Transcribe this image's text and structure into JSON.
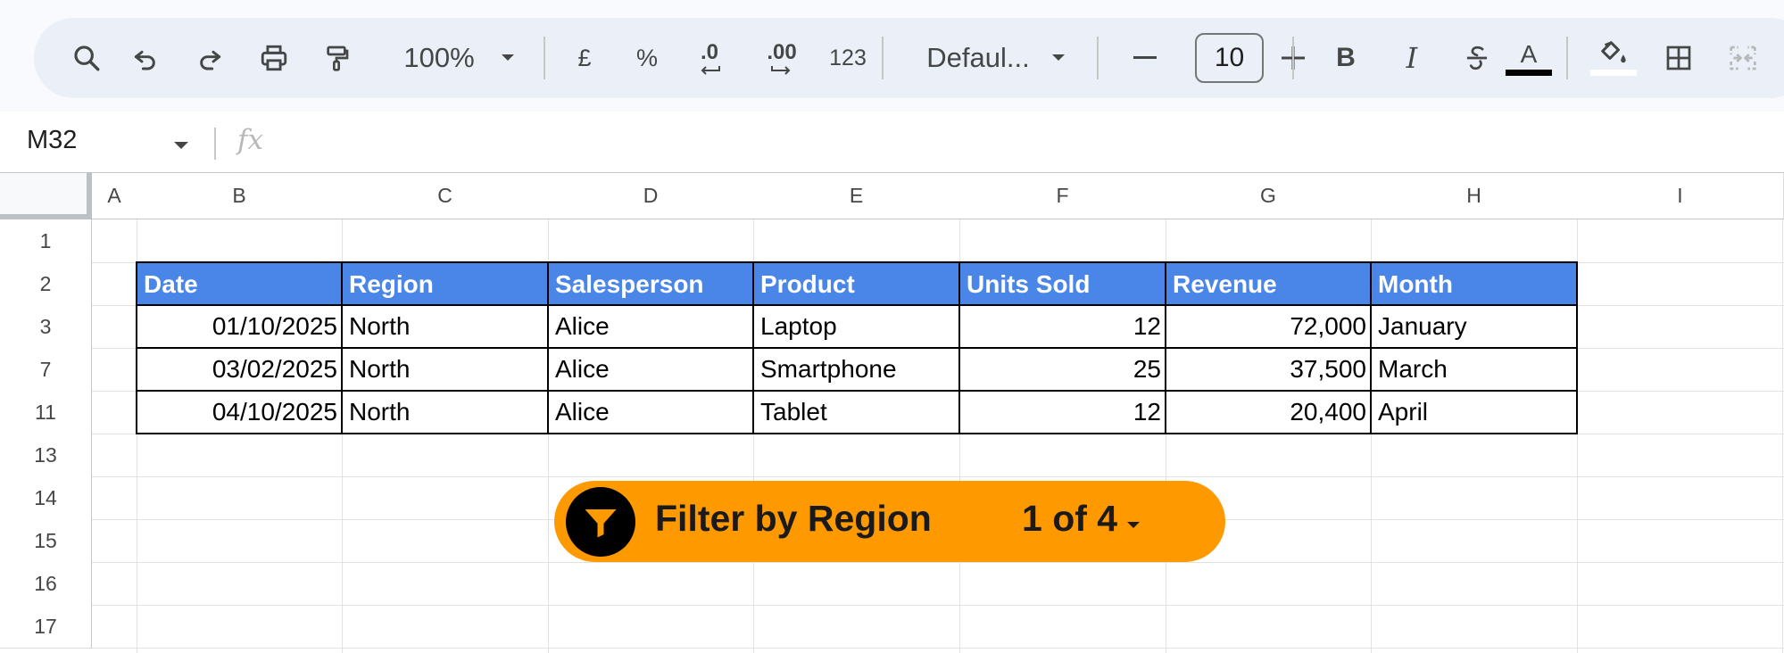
{
  "toolbar": {
    "zoom": "100%",
    "currency": "£",
    "percent": "%",
    "decrease_decimals": ".0",
    "increase_decimals": ".00",
    "number_format": "123",
    "font": "Defaul...",
    "font_size": "10",
    "text_color": "#000000",
    "fill_color": "#ffffff",
    "icons": [
      "search-icon",
      "undo-icon",
      "redo-icon",
      "print-icon",
      "paint-format-icon",
      "chevron-down-icon",
      "minus-icon",
      "plus-icon",
      "bold-icon",
      "italic-icon",
      "strikethrough-icon",
      "text-color-icon",
      "fill-color-icon",
      "borders-icon",
      "merge-cells-icon"
    ]
  },
  "formula_bar": {
    "cell_ref": "M32",
    "fx": "fx",
    "formula": ""
  },
  "grid": {
    "columns": [
      "A",
      "B",
      "C",
      "D",
      "E",
      "F",
      "G",
      "H",
      "I"
    ],
    "rows": [
      "1",
      "2",
      "3",
      "7",
      "11",
      "13",
      "14",
      "15",
      "16",
      "17"
    ],
    "table": {
      "headers": [
        "Date",
        "Region",
        "Salesperson",
        "Product",
        "Units Sold",
        "Revenue",
        "Month"
      ],
      "rows": [
        [
          "01/10/2025",
          "North",
          "Alice",
          "Laptop",
          "12",
          "72,000",
          "January"
        ],
        [
          "03/02/2025",
          "North",
          "Alice",
          "Smartphone",
          "25",
          "37,500",
          "March"
        ],
        [
          "04/10/2025",
          "North",
          "Alice",
          "Tablet",
          "12",
          "20,400",
          "April"
        ]
      ],
      "header_color": "#4a86e8"
    }
  },
  "filter_chip": {
    "label": "Filter by Region",
    "count": "1 of 4",
    "color": "#ff9900",
    "icon": "filter-icon"
  }
}
